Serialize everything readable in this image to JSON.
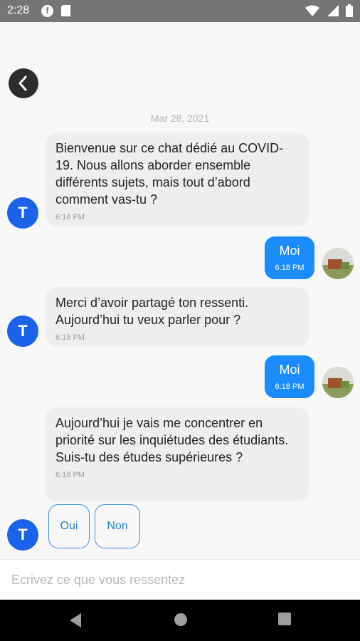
{
  "status_bar": {
    "time": "2:28",
    "icons": [
      "flipboard-icon",
      "sim-card-icon",
      "wifi-icon",
      "signal-icon",
      "battery-icon"
    ]
  },
  "chat": {
    "back_icon": "chevron-left-icon",
    "date": "Mar 28, 2021",
    "bot_avatar_letter": "T",
    "messages": [
      {
        "from": "bot",
        "text": "Bienvenue sur ce chat dédié au COVID-19. Nous allons aborder ensemble différents sujets, mais tout d’abord comment vas-tu ?",
        "time": "6:18 PM"
      },
      {
        "from": "user",
        "text": "Moi",
        "time": "6:18 PM"
      },
      {
        "from": "bot",
        "text": "Merci d’avoir partagé ton ressenti. Aujourd’hui tu veux parler pour ?",
        "time": "6:18 PM"
      },
      {
        "from": "user",
        "text": "Moi",
        "time": "6:18 PM"
      },
      {
        "from": "bot",
        "text": "Aujourd’hui je vais me concentrer en priorité sur les inquiétudes des étudiants. Suis-tu des études supérieures ?",
        "time": "6:18 PM"
      }
    ],
    "quick_replies": [
      "Oui",
      "Non"
    ]
  },
  "input": {
    "placeholder": "Ecrivez ce que vous ressentez",
    "value": ""
  },
  "colors": {
    "accent": "#1a8cff",
    "bot_avatar": "#1a63e8",
    "status_bar": "#757575",
    "nav_bar": "#000000"
  }
}
